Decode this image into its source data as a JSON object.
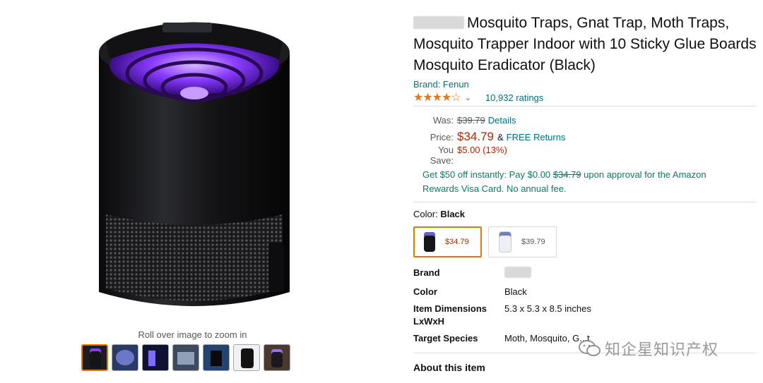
{
  "gallery": {
    "zoom_hint": "Roll over image to zoom in",
    "thumbnail_count": 7,
    "active_thumbnail": 1
  },
  "product": {
    "title": "Mosquito Traps, Gnat Trap, Moth Traps, Mosquito Trapper Indoor with 10 Sticky Glue Boards Mosquito Eradicator (Black)",
    "brand_link": "Brand: Fenun",
    "rating_stars": 4.5,
    "ratings_count": "10,932 ratings"
  },
  "pricing": {
    "was_label": "Was:",
    "was_price": "$39.79",
    "details_link": "Details",
    "price_label": "Price:",
    "price": "$34.79",
    "amp": "&",
    "free_returns": "FREE Returns",
    "save_label": "You Save:",
    "save_value": "$5.00 (13%)"
  },
  "promo": {
    "text_before": "Get $50 off instantly: Pay $0.00",
    "strike_price": "$34.79",
    "text_after": "upon approval for the Amazon Rewards Visa Card. No annual fee."
  },
  "color_selector": {
    "label": "Color:",
    "selected": "Black",
    "options": [
      {
        "price": "$34.79"
      },
      {
        "price": "$39.79"
      }
    ]
  },
  "specs": [
    {
      "key": "Brand",
      "value": ""
    },
    {
      "key": "Color",
      "value": "Black"
    },
    {
      "key": "Item Dimensions LxWxH",
      "value": "5.3 x 5.3 x 8.5 inches"
    },
    {
      "key": "Target Species",
      "value": "Moth, Mosquito, G...t"
    }
  ],
  "about_heading": "About this item",
  "watermark_text": "知企星知识产权",
  "colors": {
    "link": "#007185",
    "price": "#b12704",
    "stars": "#de7921",
    "promo": "#067d62",
    "selected_border": "#e77600"
  }
}
